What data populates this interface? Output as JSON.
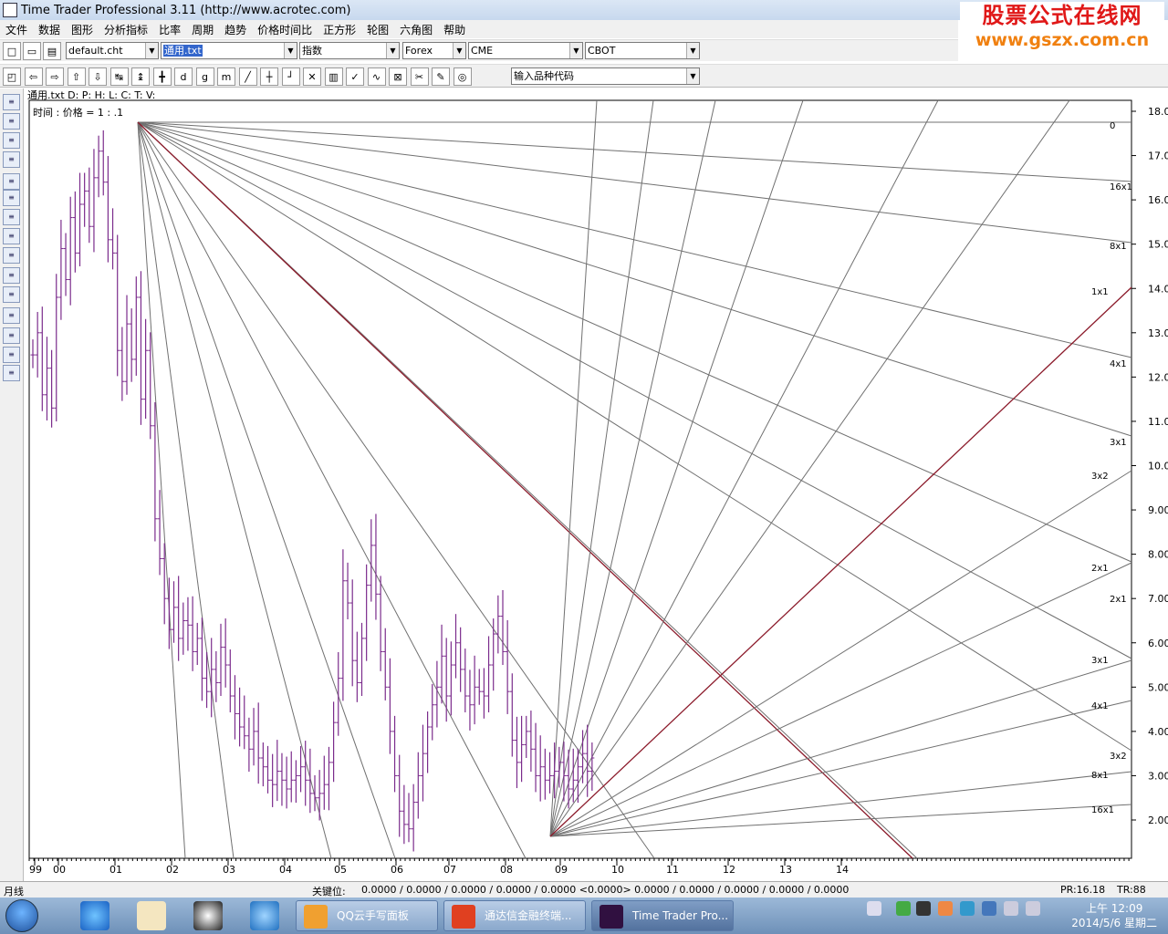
{
  "window": {
    "title": "Time Trader Professional 3.11 (http://www.acrotec.com)"
  },
  "watermark": {
    "line1": "股票公式在线网",
    "line2": "www.gszx.com.cn"
  },
  "menu": [
    "文件",
    "数据",
    "图形",
    "分析指标",
    "比率",
    "周期",
    "趋势",
    "价格时间比",
    "正方形",
    "轮图",
    "六角图",
    "帮助"
  ],
  "toolbar1": {
    "combo_file": "default.cht",
    "combo_data": "通用.txt",
    "combo_type": "指数",
    "combo_market1": "Forex",
    "combo_market2": "CME",
    "combo_market3": "CBOT"
  },
  "toolbar2": {
    "symbol_combo": "输入品种代码"
  },
  "chart_header": {
    "info": "通用.txt  D:   P:   H:   L:   C:   T:   V:",
    "scale": "时间 : 价格  = 1 :     .1"
  },
  "status": {
    "period": "月线",
    "key_label": "关键位:",
    "key_values": "0.0000 / 0.0000 / 0.0000 / 0.0000 / 0.0000 <0.0000> 0.0000 / 0.0000 / 0.0000 / 0.0000 / 0.0000",
    "pr": "PR:16.18",
    "tr": "TR:88"
  },
  "taskbar": {
    "tasks": [
      "QQ云手写面板",
      "通达信金融终端...",
      "Time Trader Pro..."
    ],
    "time": "上午 12:09",
    "date": "2014/5/6 星期二"
  },
  "colors": {
    "bars": "#7b2c8c",
    "fan_main": "#8b1a2a",
    "fan_lines": "#707070",
    "accent": "#3366cc"
  },
  "chart_data": {
    "type": "bar",
    "x_labels": [
      "99",
      "00",
      "01",
      "02",
      "03",
      "04",
      "05",
      "06",
      "07",
      "08",
      "09",
      "10",
      "11",
      "12",
      "13",
      "14"
    ],
    "y_ticks": [
      "18.00",
      "17.00",
      "16.00",
      "15.00",
      "14.00",
      "13.00",
      "12.00",
      "11.00",
      "10.00",
      "9.00",
      "8.00",
      "7.00",
      "6.00",
      "5.00",
      "4.00",
      "3.00",
      "2.00"
    ],
    "ylim": [
      1.2,
      18.2
    ],
    "fan_labels_top": [
      "0",
      "16x1",
      "8x1",
      "1x1",
      "4x1",
      "3x1",
      "3x2",
      "2x1"
    ],
    "fan_labels_bottom": [
      "2x1",
      "3x1",
      "4x1",
      "3x2",
      "8x1",
      "16x1"
    ],
    "monthly_close": [
      12.5,
      13.0,
      11.6,
      12.2,
      11.3,
      13.8,
      14.9,
      14.2,
      15.6,
      14.8,
      15.9,
      16.2,
      15.4,
      16.5,
      17.1,
      16.4,
      15.1,
      14.8,
      12.6,
      11.9,
      13.2,
      12.4,
      13.8,
      11.5,
      12.6,
      10.9,
      8.8,
      7.9,
      7.0,
      6.3,
      6.8,
      6.1,
      6.5,
      6.4,
      5.8,
      6.1,
      5.2,
      4.9,
      5.4,
      5.1,
      5.9,
      5.5,
      4.8,
      4.4,
      4.1,
      3.9,
      3.6,
      4.0,
      3.4,
      3.2,
      2.9,
      2.8,
      3.1,
      2.9,
      2.7,
      2.9,
      3.0,
      3.2,
      2.9,
      2.6,
      2.5,
      2.6,
      2.8,
      3.3,
      4.2,
      5.2,
      7.4,
      6.9,
      5.6,
      5.1,
      6.1,
      7.3,
      8.2,
      7.1,
      5.8,
      5.0,
      4.0,
      3.0,
      2.2,
      1.9,
      1.8,
      2.4,
      3.0,
      3.5,
      4.1,
      4.6,
      5.0,
      5.7,
      4.8,
      5.5,
      6.0,
      5.4,
      4.8,
      4.6,
      5.0,
      4.9,
      4.8,
      5.5,
      6.2,
      6.6,
      5.8,
      4.9,
      3.8,
      3.3,
      3.7,
      4.0,
      3.6,
      3.0,
      3.2,
      2.9,
      3.0,
      3.1,
      3.3,
      3.0,
      2.7,
      2.9,
      3.2,
      3.5,
      3.1,
      3.4
    ]
  }
}
